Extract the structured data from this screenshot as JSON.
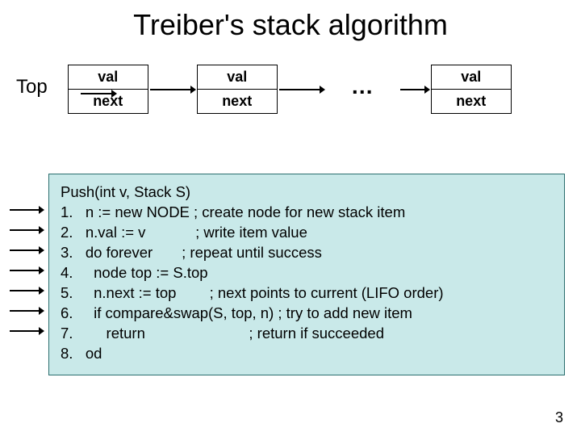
{
  "title": "Treiber's stack algorithm",
  "top_label": "Top",
  "nodes": [
    {
      "val": "val",
      "next": "next"
    },
    {
      "val": "val",
      "next": "next"
    },
    {
      "val": "val",
      "next": "next"
    }
  ],
  "ellipsis": "…",
  "code": {
    "header": "Push(int v, Stack S)",
    "lines": [
      "1.   n := new NODE ; create node for new stack item",
      "2.   n.val := v            ; write item value",
      "3.   do forever       ; repeat until success",
      "4.     node top := S.top",
      "5.     n.next := top        ; next points to current (LIFO order)",
      "6.     if compare&swap(S, top, n) ; try to add new item",
      "7.        return                         ; return if succeeded",
      "8.   od"
    ]
  },
  "page_number": "3"
}
